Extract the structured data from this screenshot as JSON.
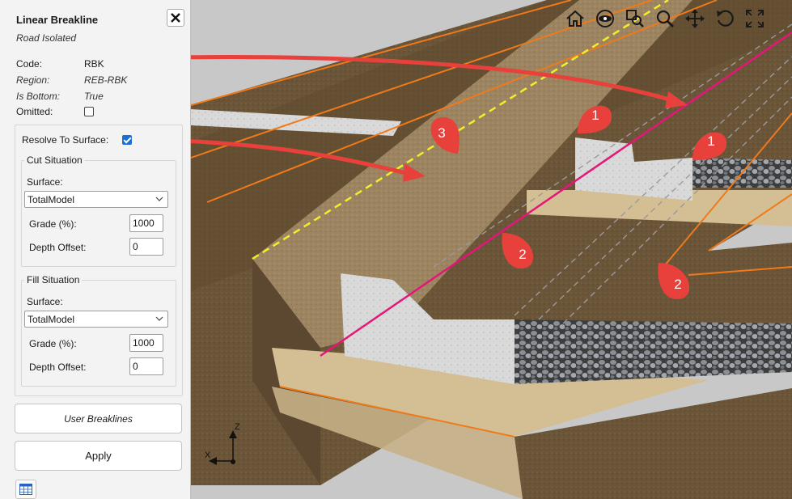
{
  "panel": {
    "title": "Linear Breakline",
    "subtitle": "Road Isolated",
    "properties": {
      "code_label": "Code:",
      "code_value": "RBK",
      "region_label": "Region:",
      "region_value": "REB-RBK",
      "is_bottom_label": "Is Bottom:",
      "is_bottom_value": "True",
      "omitted_label": "Omitted:",
      "omitted_checked": false
    },
    "resolve_label": "Resolve To Surface:",
    "resolve_checked": true,
    "cut": {
      "legend": "Cut Situation",
      "surface_label": "Surface:",
      "surface_value": "TotalModel",
      "grade_label": "Grade (%):",
      "grade_value": "1000",
      "depth_label": "Depth Offset:",
      "depth_value": "0"
    },
    "fill": {
      "legend": "Fill Situation",
      "surface_label": "Surface:",
      "surface_value": "TotalModel",
      "grade_label": "Grade (%):",
      "grade_value": "1000",
      "depth_label": "Depth Offset:",
      "depth_value": "0"
    },
    "user_breaklines_label": "User Breaklines",
    "apply_label": "Apply"
  },
  "viewport": {
    "toolbar": [
      "home-icon",
      "eye-icon",
      "zoom-window-icon",
      "zoom-icon",
      "pan-icon",
      "rotate-icon",
      "fullscreen-icon"
    ],
    "callouts": {
      "c1a": "1",
      "c1b": "1",
      "c2a": "2",
      "c2b": "2",
      "c3": "3"
    },
    "axes": {
      "z": "Z",
      "x": "X"
    }
  },
  "colors": {
    "arrow": "#e8413c",
    "callout": "#e8413c",
    "orange_line": "#f07a1a",
    "magenta_line": "#e6157a",
    "yellow_dash": "#f2ee2a",
    "soil": "#6b5538",
    "sand": "#d4bf94",
    "concrete": "#d8d8d8"
  }
}
